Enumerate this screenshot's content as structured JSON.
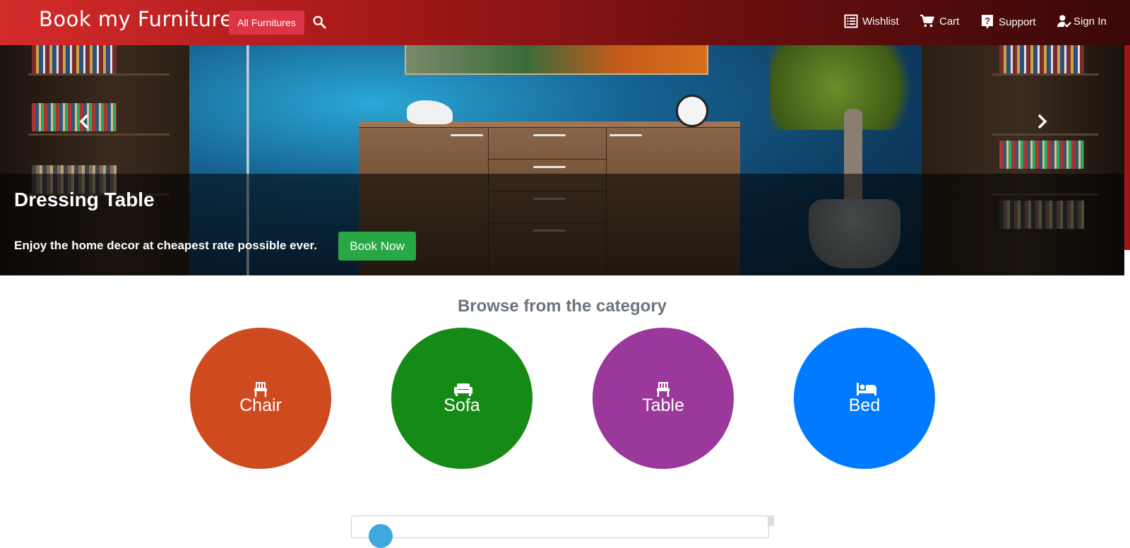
{
  "header": {
    "brand": "Book my Furniture",
    "all_button": "All Furnitures",
    "nav": [
      {
        "label": "Wishlist",
        "icon": "list-icon"
      },
      {
        "label": "Cart",
        "icon": "cart-icon"
      },
      {
        "label": "Support",
        "icon": "help-icon"
      },
      {
        "label": "Sign In",
        "icon": "user-check-icon"
      }
    ]
  },
  "hero": {
    "title": "Dressing Table",
    "text": "Enjoy the home decor at cheapest rate possible ever.",
    "button": "Book Now"
  },
  "categories": {
    "heading": "Browse from the category",
    "items": [
      {
        "label": "Chair",
        "color": "#d04a1f",
        "icon": "chair-icon"
      },
      {
        "label": "Sofa",
        "color": "#168a16",
        "icon": "sofa-icon"
      },
      {
        "label": "Table",
        "color": "#9b389b",
        "icon": "chair-icon"
      },
      {
        "label": "Bed",
        "color": "#007bff",
        "icon": "bed-icon"
      }
    ]
  },
  "colors": {
    "button_red": "#dc3545",
    "button_green": "#28a745",
    "heading_gray": "#6c757d"
  }
}
